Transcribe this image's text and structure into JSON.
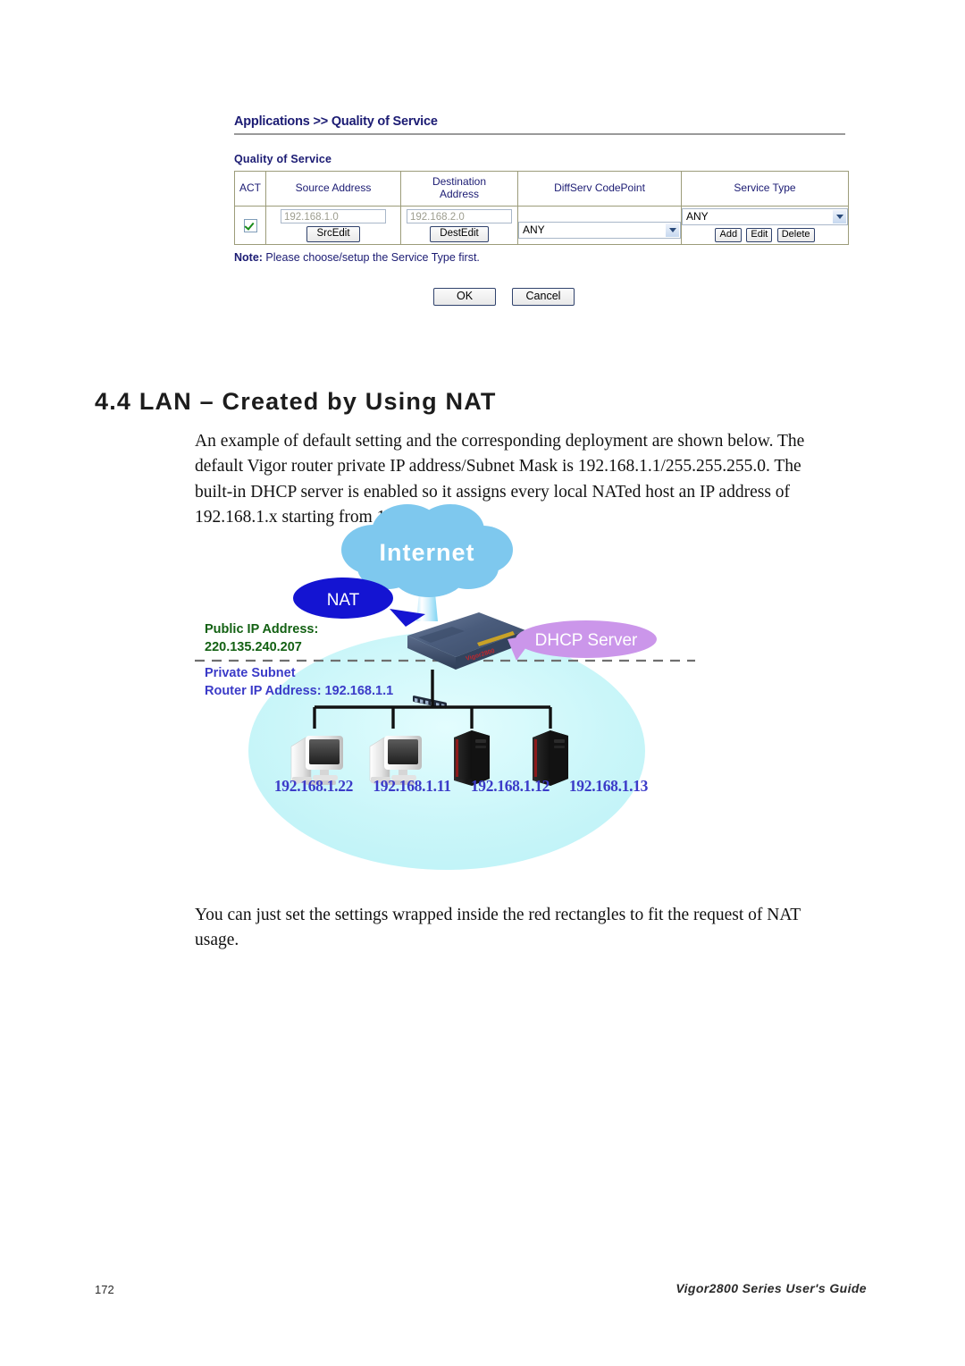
{
  "qos_panel": {
    "breadcrumb": {
      "root": "Applications",
      "separator": ">>",
      "current": "Quality of Service"
    },
    "section_title": "Quality of Service",
    "table": {
      "headers": [
        "ACT",
        "Source Address",
        "Destination Address",
        "DiffServ CodePoint",
        "Service Type"
      ],
      "header_destination_line1": "Destination",
      "header_destination_line2": "Address",
      "row": {
        "act_checked": true,
        "source_address": "192.168.1.0",
        "source_button": "SrcEdit",
        "destination_address": "192.168.2.0",
        "destination_button": "DestEdit",
        "diffserv_codepoint": "ANY",
        "service_type": "ANY",
        "service_buttons": [
          "Add",
          "Edit",
          "Delete"
        ]
      }
    },
    "note_label": "Note:",
    "note_text": " Please choose/setup the Service Type first.",
    "ok_button": "OK",
    "cancel_button": "Cancel"
  },
  "section": {
    "heading": "4.4 LAN – Created by Using NAT",
    "paragraph_1": "An example of default setting and the corresponding deployment are shown below. The default Vigor router private IP address/Subnet Mask is 192.168.1.1/255.255.255.0. The built-in DHCP server is enabled so it assigns every local NATed host an IP address of 192.168.1.x starting from 192.168.1.10.",
    "paragraph_2": "You can just set the settings wrapped inside the red rectangles to fit the request of NAT usage."
  },
  "diagram": {
    "cloud_label": "Internet",
    "nat_balloon": "NAT",
    "dhcp_balloon": "DHCP Server",
    "public_ip_line1": "Public IP Address:",
    "public_ip_line2": "220.135.240.207",
    "private_line1": "Private Subnet",
    "private_line2": "Router IP Address: 192.168.1.1",
    "hosts": [
      "192.168.1.22",
      "192.168.1.11",
      "192.168.1.12",
      "192.168.1.13"
    ],
    "colors": {
      "cloud": "#7ec8ee",
      "nat_balloon": "#1414d2",
      "dhcp_balloon": "#cb96ea",
      "lan_ellipse": "#cdf7f8",
      "public_ip_text": "#136113",
      "private_text": "#3b3bc8"
    }
  },
  "footer": {
    "page_number": "172",
    "guide_title": "Vigor2800 Series User's Guide"
  }
}
